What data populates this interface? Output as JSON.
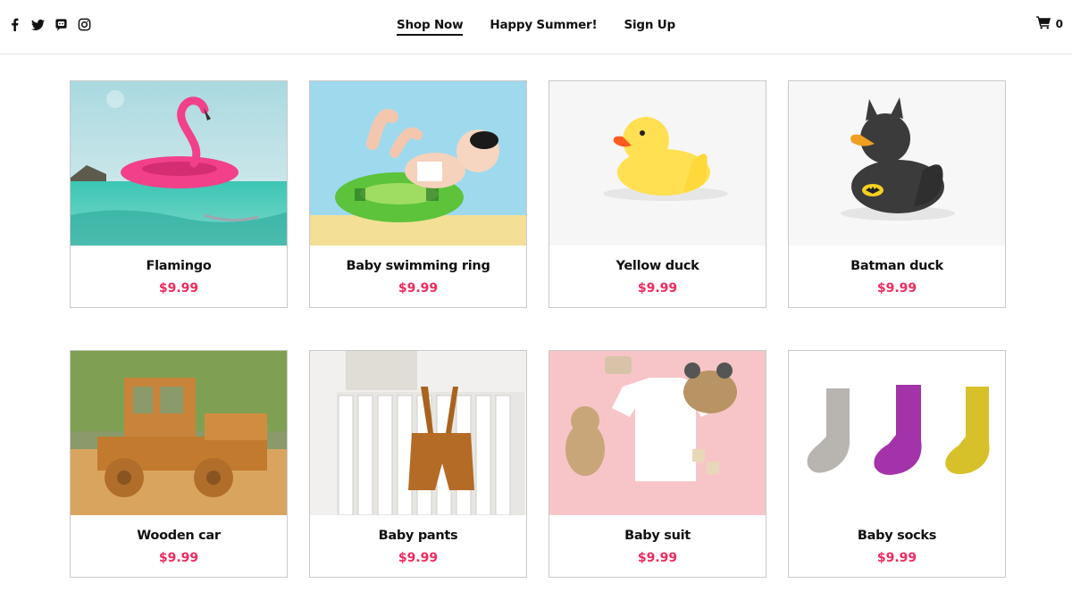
{
  "header": {
    "social_icons": [
      "facebook-icon",
      "twitter-icon",
      "discord-icon",
      "instagram-icon"
    ],
    "nav": [
      {
        "label": "Shop Now",
        "active": true
      },
      {
        "label": "Happy Summer!",
        "active": false
      },
      {
        "label": "Sign Up",
        "active": false
      }
    ],
    "cart_icon": "shopping-cart-icon",
    "cart_count": "0"
  },
  "products": [
    {
      "name": "Flamingo",
      "price": "$9.99",
      "image": "flamingo-float"
    },
    {
      "name": "Baby swimming ring",
      "price": "$9.99",
      "image": "baby-in-swim-ring"
    },
    {
      "name": "Yellow duck",
      "price": "$9.99",
      "image": "yellow-rubber-duck"
    },
    {
      "name": "Batman duck",
      "price": "$9.99",
      "image": "batman-rubber-duck"
    },
    {
      "name": "Wooden car",
      "price": "$9.99",
      "image": "wooden-toy-car"
    },
    {
      "name": "Baby pants",
      "price": "$9.99",
      "image": "baby-pants-on-radiator"
    },
    {
      "name": "Baby suit",
      "price": "$9.99",
      "image": "baby-suit-flatlay"
    },
    {
      "name": "Baby socks",
      "price": "$9.99",
      "image": "baby-socks"
    }
  ],
  "colors": {
    "price": "#ee2b5f",
    "border": "#c9c9c9",
    "text": "#111111"
  }
}
